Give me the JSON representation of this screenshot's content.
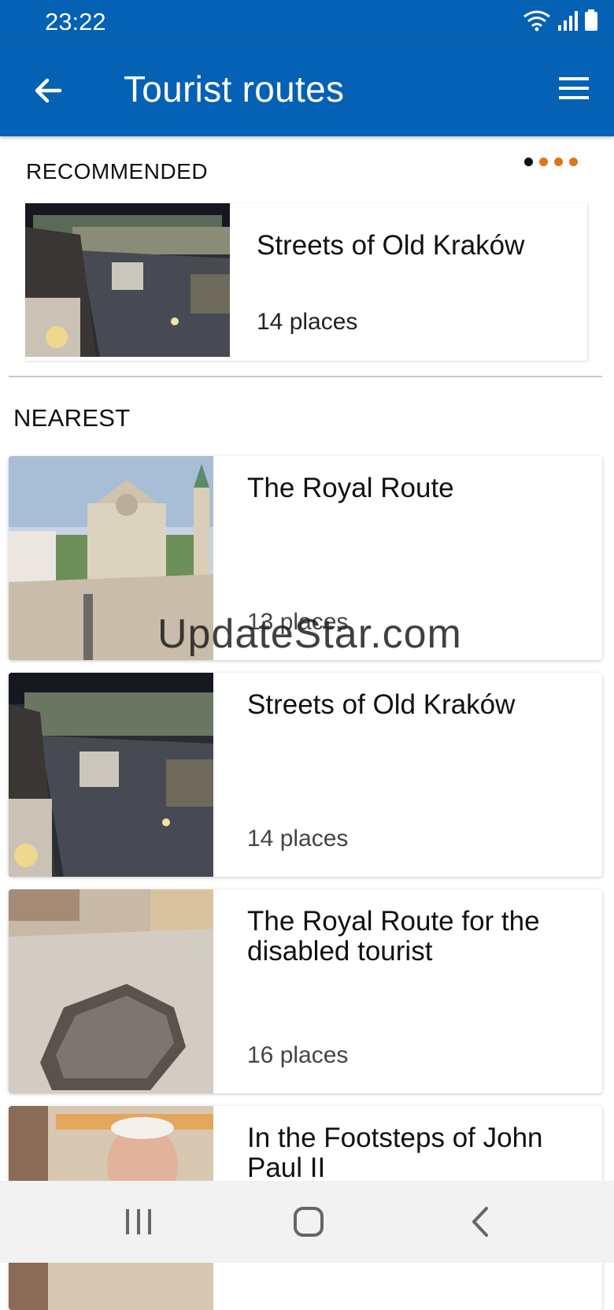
{
  "status_bar": {
    "time": "23:22",
    "icons": [
      "wifi-icon",
      "signal-icon",
      "battery-icon"
    ]
  },
  "app_bar": {
    "title": "Tourist routes",
    "back_icon": "arrow-left-icon",
    "menu_icon": "hamburger-menu-icon"
  },
  "recommended": {
    "heading": "RECOMMENDED",
    "pager_dots": {
      "count": 4,
      "active_index": 0,
      "active_color": "#111111",
      "inactive_color": "#e07418"
    },
    "card": {
      "name": "Streets of Old Kraków",
      "places": "14 places"
    }
  },
  "nearest": {
    "heading": "NEAREST",
    "routes": [
      {
        "name": "The Royal Route",
        "places": "13 places"
      },
      {
        "name": "Streets of Old Kraków",
        "places": "14 places"
      },
      {
        "name": "The Royal Route for the disabled tourist",
        "places": "16 places"
      },
      {
        "name": "In the Footsteps of John Paul II",
        "places": ""
      }
    ]
  },
  "watermark": "UpdateStar.com",
  "nav_bar": {
    "icons": [
      "recent-apps-icon",
      "home-icon",
      "back-nav-icon"
    ]
  },
  "colors": {
    "primary": "#0561b3",
    "accent": "#e07418"
  }
}
